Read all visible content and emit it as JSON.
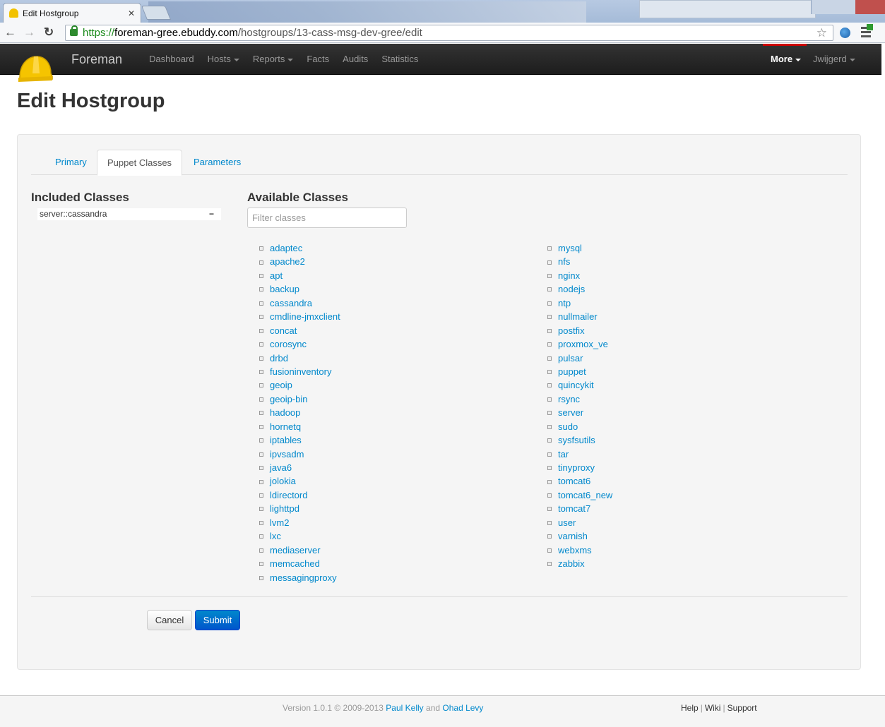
{
  "browser": {
    "tab_title": "Edit Hostgroup",
    "url_scheme": "https://",
    "url_host": "foreman-gree.ebuddy.com",
    "url_path": "/hostgroups/13-cass-msg-dev-gree/edit"
  },
  "navbar": {
    "brand": "Foreman",
    "items": [
      "Dashboard",
      "Hosts",
      "Reports",
      "Facts",
      "Audits",
      "Statistics"
    ],
    "more": "More",
    "user": "Jwijgerd"
  },
  "page": {
    "title": "Edit Hostgroup",
    "tabs": [
      "Primary",
      "Puppet Classes",
      "Parameters"
    ],
    "active_tab": "Puppet Classes"
  },
  "included": {
    "heading": "Included Classes",
    "items": [
      "server::cassandra"
    ],
    "remove_label": "−"
  },
  "available": {
    "heading": "Available Classes",
    "filter_placeholder": "Filter classes",
    "column1": [
      "adaptec",
      "apache2",
      "apt",
      "backup",
      "cassandra",
      "cmdline-jmxclient",
      "concat",
      "corosync",
      "drbd",
      "fusioninventory",
      "geoip",
      "geoip-bin",
      "hadoop",
      "hornetq",
      "iptables",
      "ipvsadm",
      "java6",
      "jolokia",
      "ldirectord",
      "lighttpd",
      "lvm2",
      "lxc",
      "mediaserver",
      "memcached",
      "messagingproxy"
    ],
    "column2": [
      "mysql",
      "nfs",
      "nginx",
      "nodejs",
      "ntp",
      "nullmailer",
      "postfix",
      "proxmox_ve",
      "pulsar",
      "puppet",
      "quincykit",
      "rsync",
      "server",
      "sudo",
      "sysfsutils",
      "tar",
      "tinyproxy",
      "tomcat6",
      "tomcat6_new",
      "tomcat7",
      "user",
      "varnish",
      "webxms",
      "zabbix"
    ]
  },
  "actions": {
    "cancel": "Cancel",
    "submit": "Submit"
  },
  "footer": {
    "version_prefix": "Version 1.0.1 © 2009-2013",
    "author1": "Paul Kelly",
    "and": "and",
    "author2": "Ohad Levy",
    "links": [
      "Help",
      "Wiki",
      "Support"
    ]
  }
}
